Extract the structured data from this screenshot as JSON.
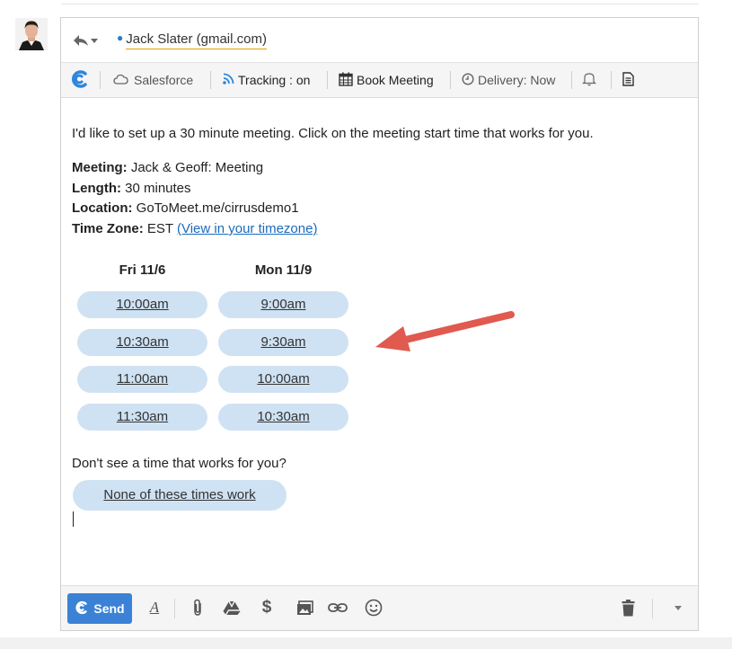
{
  "header": {
    "recipient": "Jack Slater (gmail.com)"
  },
  "toolbar": {
    "salesforce": "Salesforce",
    "tracking": "Tracking : on",
    "book_meeting": "Book Meeting",
    "delivery": "Delivery: Now"
  },
  "body": {
    "intro": "I'd like to set up a 30 minute meeting. Click on the meeting start time that works for you.",
    "meeting_label": "Meeting:",
    "meeting_value": " Jack & Geoff: Meeting",
    "length_label": "Length:",
    "length_value": " 30 minutes",
    "location_label": "Location:",
    "location_value": " GoToMeet.me/cirrusdemo1",
    "timezone_label": "Time Zone:",
    "timezone_value": " EST ",
    "timezone_link": "(View in your timezone)",
    "days": [
      {
        "label": "Fri 11/6",
        "slots": [
          "10:00am",
          "10:30am",
          "11:00am",
          "11:30am"
        ]
      },
      {
        "label": "Mon 11/9",
        "slots": [
          "9:00am",
          "9:30am",
          "10:00am",
          "10:30am"
        ]
      }
    ],
    "no_time_prompt": "Don't see a time that works for you?",
    "none_button": "None of these times work"
  },
  "footer": {
    "send": "Send"
  },
  "colors": {
    "accent": "#3b82d6",
    "slot_bg": "#cfe2f3",
    "link": "#1a6bbd",
    "arrow": "#e05a4f"
  },
  "icons": [
    "reply-icon",
    "cirrus-logo-icon",
    "salesforce-cloud-icon",
    "rss-icon",
    "calendar-icon",
    "clock-icon",
    "bell-icon",
    "document-icon",
    "text-format-icon",
    "attachment-icon",
    "drive-icon",
    "dollar-icon",
    "photo-icon",
    "link-icon",
    "emoji-icon",
    "trash-icon",
    "more-options-icon"
  ]
}
